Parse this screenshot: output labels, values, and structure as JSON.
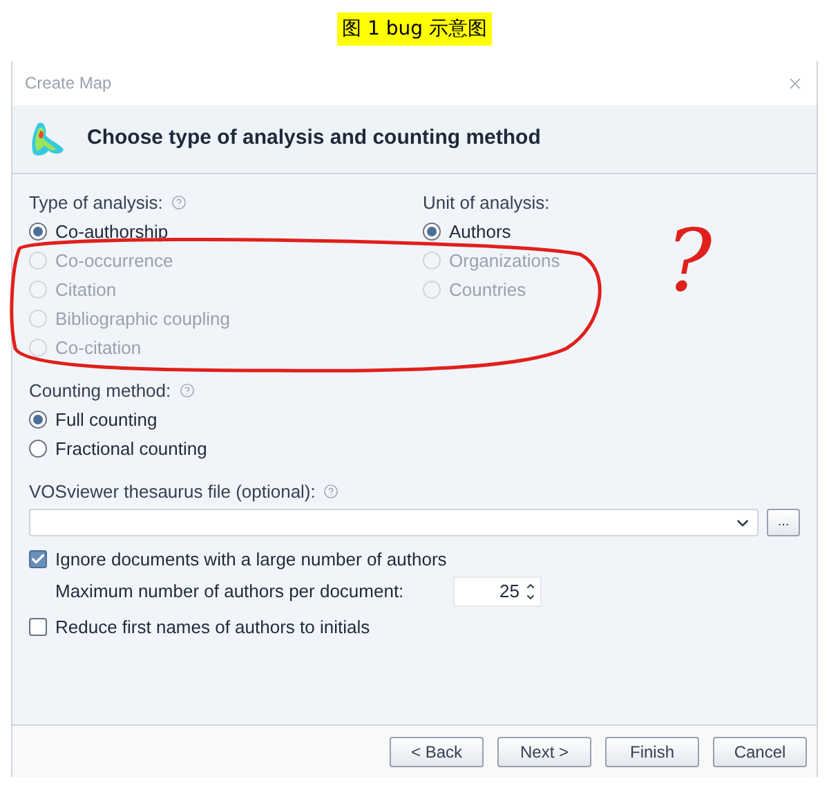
{
  "caption": "图 1 bug 示意图",
  "window": {
    "title": "Create Map"
  },
  "header": {
    "title": "Choose type of analysis and counting method"
  },
  "type_of_analysis": {
    "label": "Type of analysis:",
    "options": [
      {
        "label": "Co-authorship",
        "selected": true,
        "disabled": false
      },
      {
        "label": "Co-occurrence",
        "selected": false,
        "disabled": true
      },
      {
        "label": "Citation",
        "selected": false,
        "disabled": true
      },
      {
        "label": "Bibliographic coupling",
        "selected": false,
        "disabled": true
      },
      {
        "label": "Co-citation",
        "selected": false,
        "disabled": true
      }
    ]
  },
  "unit_of_analysis": {
    "label": "Unit of analysis:",
    "options": [
      {
        "label": "Authors",
        "selected": true,
        "disabled": false
      },
      {
        "label": "Organizations",
        "selected": false,
        "disabled": true
      },
      {
        "label": "Countries",
        "selected": false,
        "disabled": true
      }
    ]
  },
  "counting_method": {
    "label": "Counting method:",
    "options": [
      {
        "label": "Full counting",
        "selected": true,
        "disabled": false
      },
      {
        "label": "Fractional counting",
        "selected": false,
        "disabled": false
      }
    ]
  },
  "thesaurus": {
    "label": "VOSviewer thesaurus file (optional):",
    "browse": "..."
  },
  "ignore_documents": {
    "label": "Ignore documents with a large number of authors",
    "checked": true
  },
  "max_authors": {
    "label": "Maximum number of authors per document:",
    "value": "25"
  },
  "reduce_names": {
    "label": "Reduce first names of authors to initials",
    "checked": false
  },
  "buttons": [
    "< Back",
    "Next >",
    "Finish",
    "Cancel"
  ],
  "annotation": {
    "mark": "?"
  }
}
